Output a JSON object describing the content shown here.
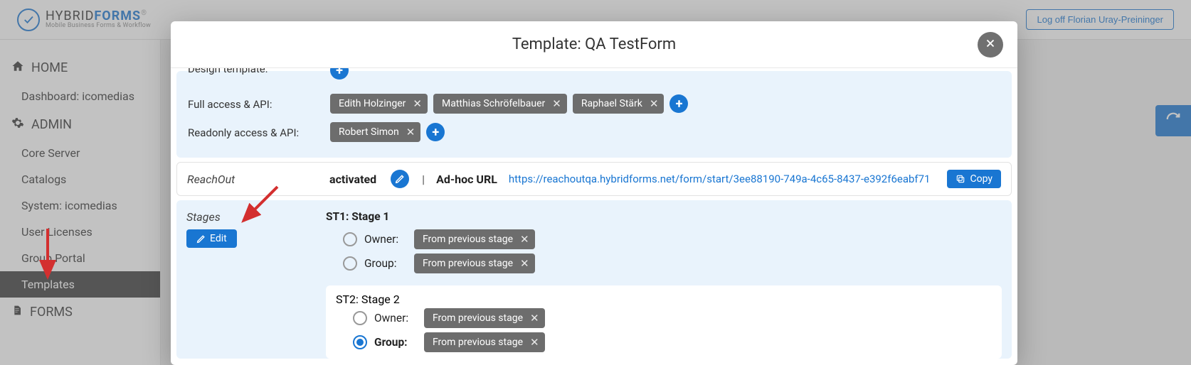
{
  "brand": {
    "name_a": "HYBRID",
    "name_b": "FORMS",
    "tagline": "Mobile Business Forms & Workflow"
  },
  "topbar": {
    "logoff": "Log off Florian Uray-Preininger"
  },
  "sidebar": {
    "home_label": "HOME",
    "dashboard_label": "Dashboard: icomedias",
    "admin_label": "ADMIN",
    "items": [
      {
        "label": "Core Server"
      },
      {
        "label": "Catalogs"
      },
      {
        "label": "System: icomedias"
      },
      {
        "label": "User Licenses"
      },
      {
        "label": "Group Portal"
      },
      {
        "label": "Templates"
      }
    ],
    "forms_label": "FORMS"
  },
  "modal": {
    "title": "Template: QA TestForm",
    "design_template_label": "Design template:",
    "full_access": {
      "label": "Full access & API:",
      "chips": [
        "Edith Holzinger",
        "Matthias Schröfelbauer",
        "Raphael Stärk"
      ]
    },
    "readonly_access": {
      "label": "Readonly access & API:",
      "chips": [
        "Robert Simon"
      ]
    },
    "reachout": {
      "title": "ReachOut",
      "status": "activated",
      "adhoc_label": "Ad-hoc URL",
      "url": "https://reachoutqa.hybridforms.net/form/start/3ee88190-749a-4c65-8437-e392f6eabf71",
      "copy": "Copy"
    },
    "stages": {
      "title": "Stages",
      "edit": "Edit",
      "from_prev": "From previous stage",
      "owner_label": "Owner:",
      "group_label": "Group:",
      "st1": "ST1: Stage 1",
      "st2": "ST2: Stage 2"
    }
  }
}
